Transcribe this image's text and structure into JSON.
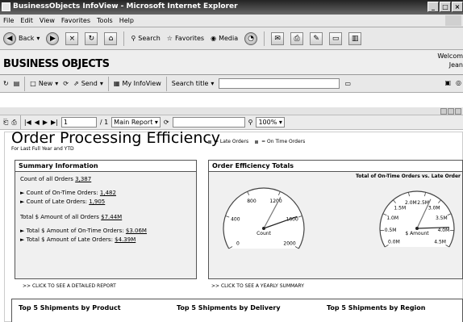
{
  "window": {
    "title": "BusinessObjects InfoView - Microsoft Internet Explorer"
  },
  "menu": [
    "File",
    "Edit",
    "View",
    "Favorites",
    "Tools",
    "Help"
  ],
  "toolbar": {
    "back": "Back",
    "search": "Search",
    "favorites": "Favorites",
    "media": "Media"
  },
  "brand": {
    "logo": "BUSINESS OBJECTS",
    "welcome": "Welcom",
    "user": "Jean"
  },
  "infoview": {
    "new": "New",
    "send": "Send",
    "my_infoview": "My InfoView",
    "search_title": "Search title"
  },
  "report_toolbar": {
    "page": "1",
    "of_pages": "/ 1",
    "report": "Main Report",
    "zoom": "100%"
  },
  "report": {
    "title": "Order Processing Efficiency",
    "subtitle": "For Last Full Year and YTD",
    "legend_late": "= Late Orders",
    "legend_ontime": "= On Time Orders",
    "summary": {
      "title": "Summary Information",
      "count_all_label": "Count of all Orders",
      "count_all": "3,387",
      "count_ontime_label": "Count of On-Time Orders:",
      "count_ontime": "1,482",
      "count_late_label": "Count of Late Orders:",
      "count_late": "1,905",
      "amount_all_label": "Total $ Amount of all Orders",
      "amount_all": "$7.44M",
      "amount_ontime_label": "Total $ Amount of On-Time Orders:",
      "amount_ontime": "$3.06M",
      "amount_late_label": "Total $ Amount of Late Orders:",
      "amount_late": "$4.39M",
      "link": ">> CLICK TO SEE A DETAILED REPORT"
    },
    "efficiency": {
      "title": "Order Efficiency Totals",
      "chart_title": "Total of On-Time Orders vs. Late Order",
      "link": ">> CLICK TO SEE A YEARLY SUMMARY"
    },
    "bottom": [
      "Top 5 Shipments by Product",
      "Top 5 Shipments by Delivery",
      "Top 5 Shipments by Region"
    ]
  },
  "chart_data": [
    {
      "type": "gauge",
      "title": "",
      "label": "Count",
      "tick_labels": [
        "0",
        "400",
        "800",
        "1200",
        "1600",
        "2000"
      ],
      "needles": [
        {
          "series": "Late Orders",
          "value": 1905
        },
        {
          "series": "On Time Orders",
          "value": 1482
        }
      ]
    },
    {
      "type": "gauge",
      "title": "Total of On-Time Orders vs. Late Order",
      "label": "$ Amount",
      "tick_labels": [
        "0.0M",
        "0.5M",
        "1.0M",
        "1.5M",
        "2.0M",
        "2.5M",
        "3.0M",
        "3.5M",
        "4.0M",
        "4.5M"
      ],
      "needles": [
        {
          "series": "Late Orders",
          "value_millions": 4.39
        },
        {
          "series": "On Time Orders",
          "value_millions": 3.06
        }
      ]
    }
  ]
}
